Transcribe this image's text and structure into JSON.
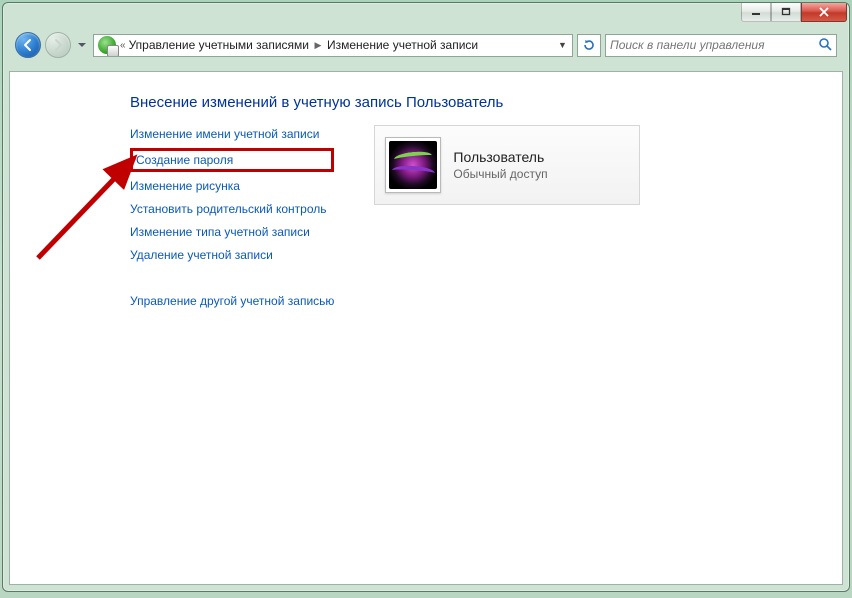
{
  "breadcrumb": {
    "item1": "Управление учетными записями",
    "item2": "Изменение учетной записи"
  },
  "search": {
    "placeholder": "Поиск в панели управления"
  },
  "page": {
    "heading": "Внесение изменений в учетную запись Пользователь"
  },
  "links": {
    "change_name": "Изменение имени учетной записи",
    "create_password": "Создание пароля",
    "change_picture": "Изменение рисунка",
    "parental_controls": "Установить родительский контроль",
    "change_type": "Изменение типа учетной записи",
    "delete_account": "Удаление учетной записи",
    "manage_other": "Управление другой учетной записью"
  },
  "user": {
    "name": "Пользователь",
    "role": "Обычный доступ"
  }
}
